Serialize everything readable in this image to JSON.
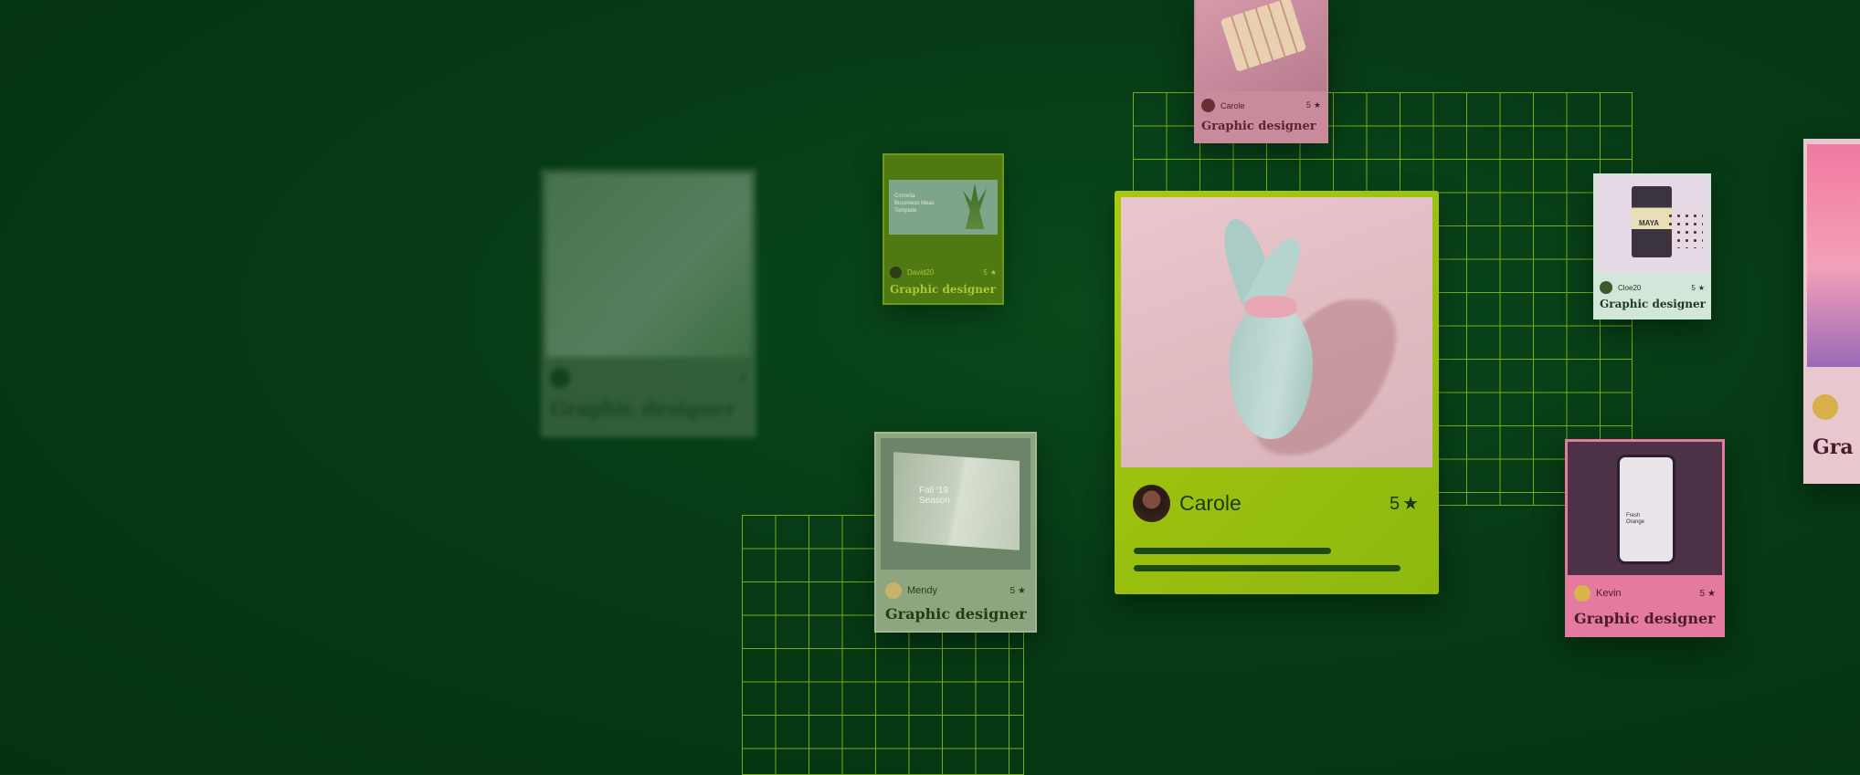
{
  "cards": {
    "faded": {
      "name": "",
      "rating": "",
      "role": "Graphic designer"
    },
    "david": {
      "name": "David20",
      "rating": "5",
      "role": "Graphic designer",
      "image_text": "Cornelia Bussiness Ideas Template"
    },
    "mendy": {
      "name": "Mendy",
      "rating": "5",
      "role": "Graphic designer",
      "image_text": "Fall '19 Season"
    },
    "carole_top": {
      "name": "Carole",
      "rating": "5",
      "role": "Graphic designer"
    },
    "carole_main": {
      "name": "Carole",
      "rating": "5"
    },
    "cloe": {
      "name": "Cloe20",
      "rating": "5",
      "role": "Graphic designer",
      "product_label": "MAYA"
    },
    "kevin": {
      "name": "Kevin",
      "rating": "5",
      "role": "Graphic designer",
      "image_text": "Fresh Orange"
    },
    "edge": {
      "role": "Gra"
    }
  },
  "colors": {
    "background": "#053a15",
    "grid": "#8fbf1f",
    "main_card": "#a3c614",
    "pink_card": "#e77aa0",
    "mint_card": "#cfe3d7"
  }
}
